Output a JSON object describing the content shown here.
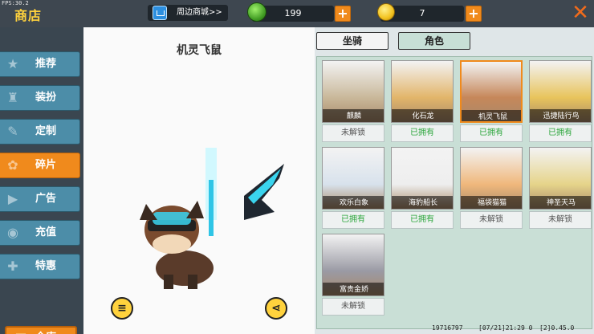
{
  "fps": "FPS:30.2",
  "header": {
    "title": "商店",
    "mall_label": "周边商城>>",
    "gems": "199",
    "coins": "7",
    "plus": "+",
    "close": "✕"
  },
  "sidebar": {
    "items": [
      {
        "label": "推荐",
        "icon": "recommend-icon",
        "glyph": "★"
      },
      {
        "label": "装扮",
        "icon": "outfit-icon",
        "glyph": "♜"
      },
      {
        "label": "定制",
        "icon": "custom-icon",
        "glyph": "✎"
      },
      {
        "label": "碎片",
        "icon": "fragment-icon",
        "glyph": "✿"
      },
      {
        "label": "广告",
        "icon": "ad-icon",
        "glyph": "▶"
      },
      {
        "label": "充值",
        "icon": "recharge-icon",
        "glyph": "◉"
      },
      {
        "label": "特惠",
        "icon": "sale-icon",
        "glyph": "✚"
      }
    ],
    "active_index": 3,
    "warehouse": "仓库"
  },
  "preview": {
    "name": "机灵飞鼠",
    "menu_icon": "≡",
    "share_icon": "⋖"
  },
  "tabs": [
    {
      "label": "坐骑",
      "active": false
    },
    {
      "label": "角色",
      "active": true
    }
  ],
  "cards": [
    {
      "name": "麒麟",
      "status": "未解锁",
      "owned": false,
      "color": "#c9b89a",
      "selected": false
    },
    {
      "name": "化石龙",
      "status": "已拥有",
      "owned": true,
      "color": "#e2b56a",
      "selected": false
    },
    {
      "name": "机灵飞鼠",
      "status": "已拥有",
      "owned": true,
      "color": "#c6875a",
      "selected": true
    },
    {
      "name": "迅捷陆行鸟",
      "status": "已拥有",
      "owned": true,
      "color": "#e8c45c",
      "selected": false
    },
    {
      "name": "欢乐白象",
      "status": "已拥有",
      "owned": true,
      "color": "#d8e2ec",
      "selected": false
    },
    {
      "name": "海豹船长",
      "status": "已拥有",
      "owned": true,
      "color": "#eeeeee",
      "selected": false
    },
    {
      "name": "福袋猫猫",
      "status": "未解锁",
      "owned": false,
      "color": "#f0b87c",
      "selected": false
    },
    {
      "name": "神圣天马",
      "status": "未解锁",
      "owned": false,
      "color": "#e6d48a",
      "selected": false
    },
    {
      "name": "富贵金娇",
      "status": "未解锁",
      "owned": false,
      "color": "#9a9aa4",
      "selected": false
    }
  ],
  "footer": {
    "id": "19716797",
    "info": "[07/21]21:29 0",
    "version": "[2]0.45.0"
  }
}
